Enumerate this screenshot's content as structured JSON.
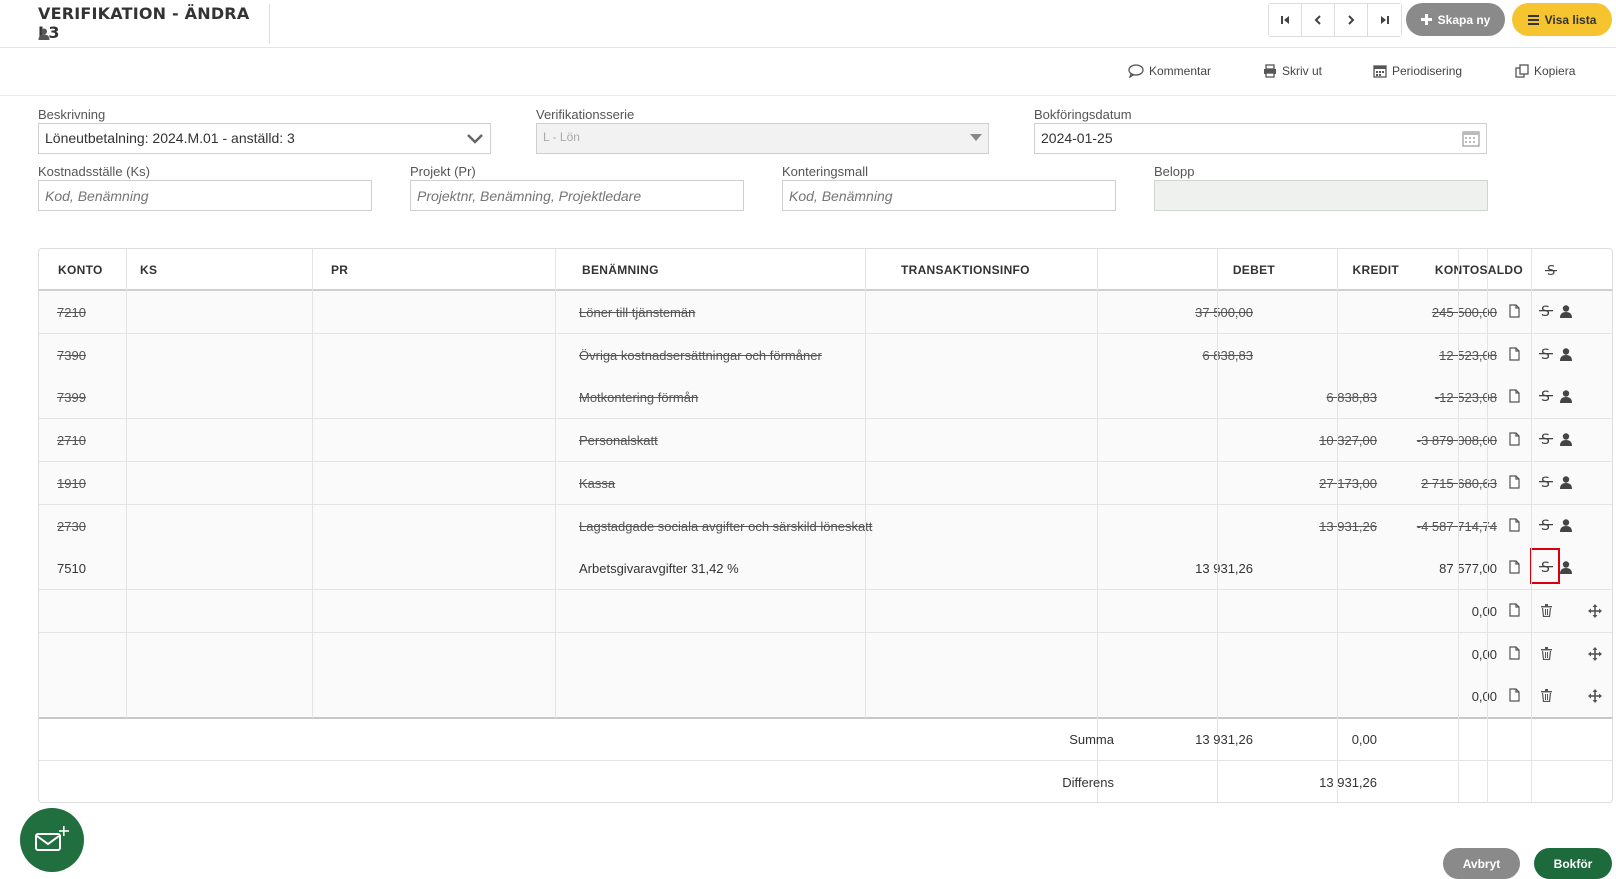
{
  "header": {
    "title": "VERIFIKATION - ÄNDRA L3"
  },
  "nav": {
    "new_label": "Skapa ny",
    "list_label": "Visa lista"
  },
  "toolbar": {
    "comment": "Kommentar",
    "print": "Skriv ut",
    "accrual": "Periodisering",
    "copy": "Kopiera"
  },
  "form": {
    "description_label": "Beskrivning",
    "description_value": "Löneutbetalning: 2024.M.01 - anställd: 3",
    "series_label": "Verifikationsserie",
    "series_value": "L - Lön",
    "date_label": "Bokföringsdatum",
    "date_value": "2024-01-25",
    "ks_label": "Kostnadsställe (Ks)",
    "ks_placeholder": "Kod, Benämning",
    "project_label": "Projekt (Pr)",
    "project_placeholder": "Projektnr, Benämning, Projektledare",
    "template_label": "Konteringsmall",
    "template_placeholder": "Kod, Benämning",
    "amount_label": "Belopp"
  },
  "table": {
    "headers": {
      "konto": "KONTO",
      "ks": "KS",
      "pr": "PR",
      "benamning": "BENÄMNING",
      "transinfo": "TRANSAKTIONSINFO",
      "debet": "DEBET",
      "kredit": "KREDIT",
      "saldo": "KONTOSALDO"
    },
    "rows": [
      {
        "konto": "7210",
        "benamning": "Löner till tjänstemän",
        "debet": "37 500,00",
        "kredit": "",
        "saldo": "245 500,00"
      },
      {
        "konto": "7390",
        "benamning": "Övriga kostnadsersättningar och förmåner",
        "debet": "6 838,83",
        "kredit": "",
        "saldo": "12 523,08"
      },
      {
        "konto": "7399",
        "benamning": "Motkontering förmån",
        "debet": "",
        "kredit": "6 838,83",
        "saldo": "-12 523,08"
      },
      {
        "konto": "2710",
        "benamning": "Personalskatt",
        "debet": "",
        "kredit": "10 327,00",
        "saldo": "-3 879 008,00"
      },
      {
        "konto": "1910",
        "benamning": "Kassa",
        "debet": "",
        "kredit": "27 173,00",
        "saldo": "2 715 680,63"
      },
      {
        "konto": "2730",
        "benamning": "Lagstadgade sociala avgifter och särskild löneskatt",
        "debet": "",
        "kredit": "13 931,26",
        "saldo": "-4 587 714,74"
      },
      {
        "konto": "7510",
        "benamning": "Arbetsgivaravgifter 31,42 %",
        "debet": "13 931,26",
        "kredit": "",
        "saldo": "87 577,00"
      },
      {
        "saldo": "0,00"
      },
      {
        "saldo": "0,00"
      },
      {
        "saldo": "0,00"
      }
    ],
    "sum_label": "Summa",
    "sum_debet": "13 931,26",
    "sum_kredit": "0,00",
    "diff_label": "Differens",
    "diff_kredit": "13 931,26"
  },
  "actions": {
    "cancel": "Avbryt",
    "book": "Bokför"
  }
}
